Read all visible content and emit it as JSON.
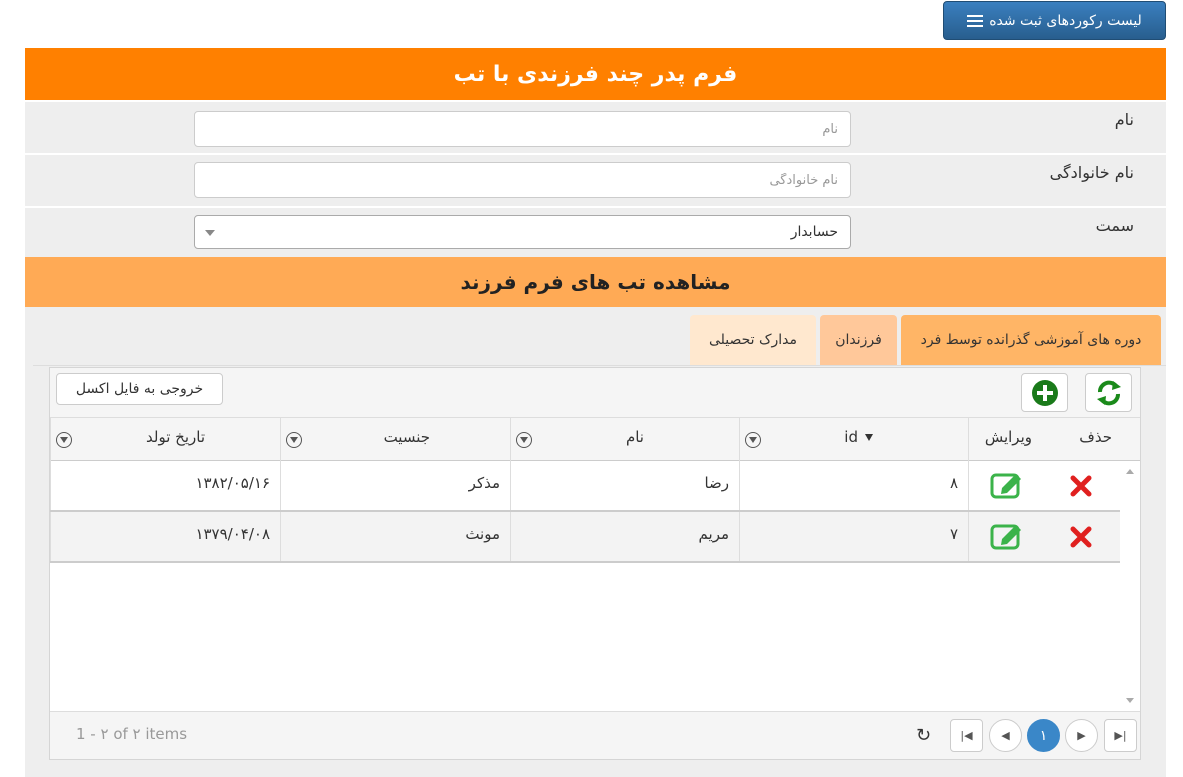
{
  "top_button": {
    "label": "لیست رکوردهای ثبت شده",
    "icon": "list-icon"
  },
  "form": {
    "title": "فرم پدر چند فرزندی با تب",
    "fields": {
      "name": {
        "label": "نام",
        "placeholder": "نام",
        "value": ""
      },
      "family": {
        "label": "نام خانوادگی",
        "placeholder": "نام خانوادگی",
        "value": ""
      },
      "position": {
        "label": "سمت",
        "value": "حسابدار"
      }
    }
  },
  "tabs_section": {
    "title": "مشاهده تب های فرم فرزند",
    "tabs": [
      {
        "label": "دوره های آموزشی گذرانده توسط فرد"
      },
      {
        "label": "فرزندان"
      },
      {
        "label": "مدارک تحصیلی"
      }
    ]
  },
  "grid": {
    "excel_label": "خروجی به فایل اکسل",
    "columns": {
      "delete": "حذف",
      "edit": "ویرایش",
      "id": "id",
      "name": "نام",
      "gender": "جنسیت",
      "birth": "تاریخ تولد"
    },
    "rows": [
      {
        "id": "۸",
        "name": "رضا",
        "gender": "مذکر",
        "birth": "۱۳۸۲/۰۵/۱۶"
      },
      {
        "id": "۷",
        "name": "مریم",
        "gender": "مونث",
        "birth": "۱۳۷۹/۰۴/۰۸"
      }
    ],
    "pager": {
      "info": "1 - ۲ of ۲ items",
      "current_page": "۱"
    }
  },
  "colors": {
    "header_orange": "#ff8000",
    "section_orange": "#ffaa55",
    "primary_blue": "#2e6da4",
    "add_green": "#1a7a1a",
    "delete_red": "#e0201f",
    "edit_green": "#3bb34a"
  }
}
